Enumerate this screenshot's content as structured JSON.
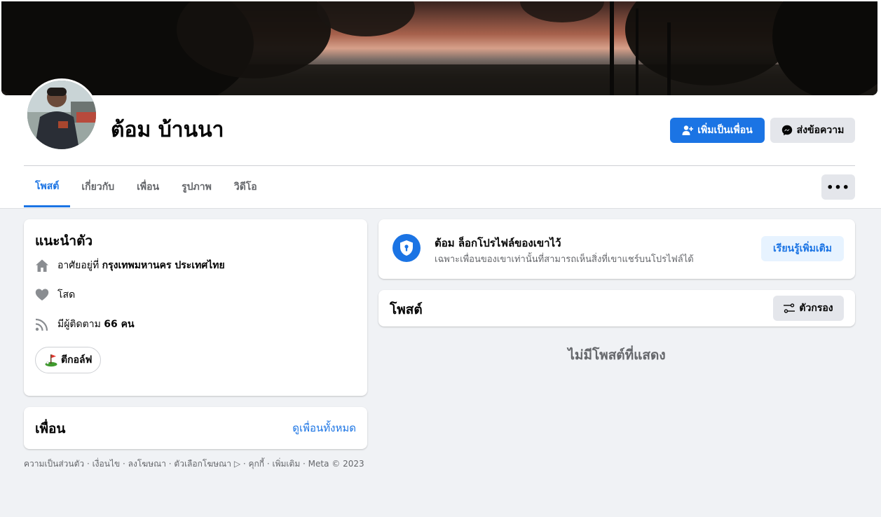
{
  "profile": {
    "name": "ต้อม บ้านนา",
    "add_friend_label": "เพิ่มเป็นเพื่อน",
    "message_label": "ส่งข้อความ"
  },
  "tabs": [
    {
      "label": "โพสต์"
    },
    {
      "label": "เกี่ยวกับ"
    },
    {
      "label": "เพื่อน"
    },
    {
      "label": "รูปภาพ"
    },
    {
      "label": "วิดีโอ"
    }
  ],
  "more_label": "•••",
  "intro": {
    "title": "แนะนำตัว",
    "lives_prefix": "อาศัยอยู่ที่",
    "lives_city": "กรุงเทพมหานคร ประเทศไทย",
    "relationship": "โสด",
    "followers_prefix": "มีผู้ติดตาม",
    "followers_count": "66 คน",
    "hobby": "ตีกอล์ฟ"
  },
  "friends_card": {
    "title": "เพื่อน",
    "see_all": "ดูเพื่อนทั้งหมด"
  },
  "footer": "ความเป็นส่วนตัว · เงื่อนไข · ลงโฆษณา · ตัวเลือกโฆษณา ▷ · คุกกี้ · เพิ่มเติม · Meta © 2023",
  "locked": {
    "title": "ต้อม ล็อกโปรไฟล์ของเขาไว้",
    "subtitle": "เฉพาะเพื่อนของเขาเท่านั้นที่สามารถเห็นสิ่งที่เขาแชร์บนโปรไฟล์ได้",
    "learn_more": "เรียนรู้เพิ่มเติม"
  },
  "posts": {
    "title": "โพสต์",
    "filter_label": "ตัวกรอง",
    "empty_text": "ไม่มีโพสต์ที่แสดง"
  },
  "colors": {
    "accent": "#1b74e4",
    "background": "#f0f2f5",
    "secondary_text": "#65676b"
  }
}
